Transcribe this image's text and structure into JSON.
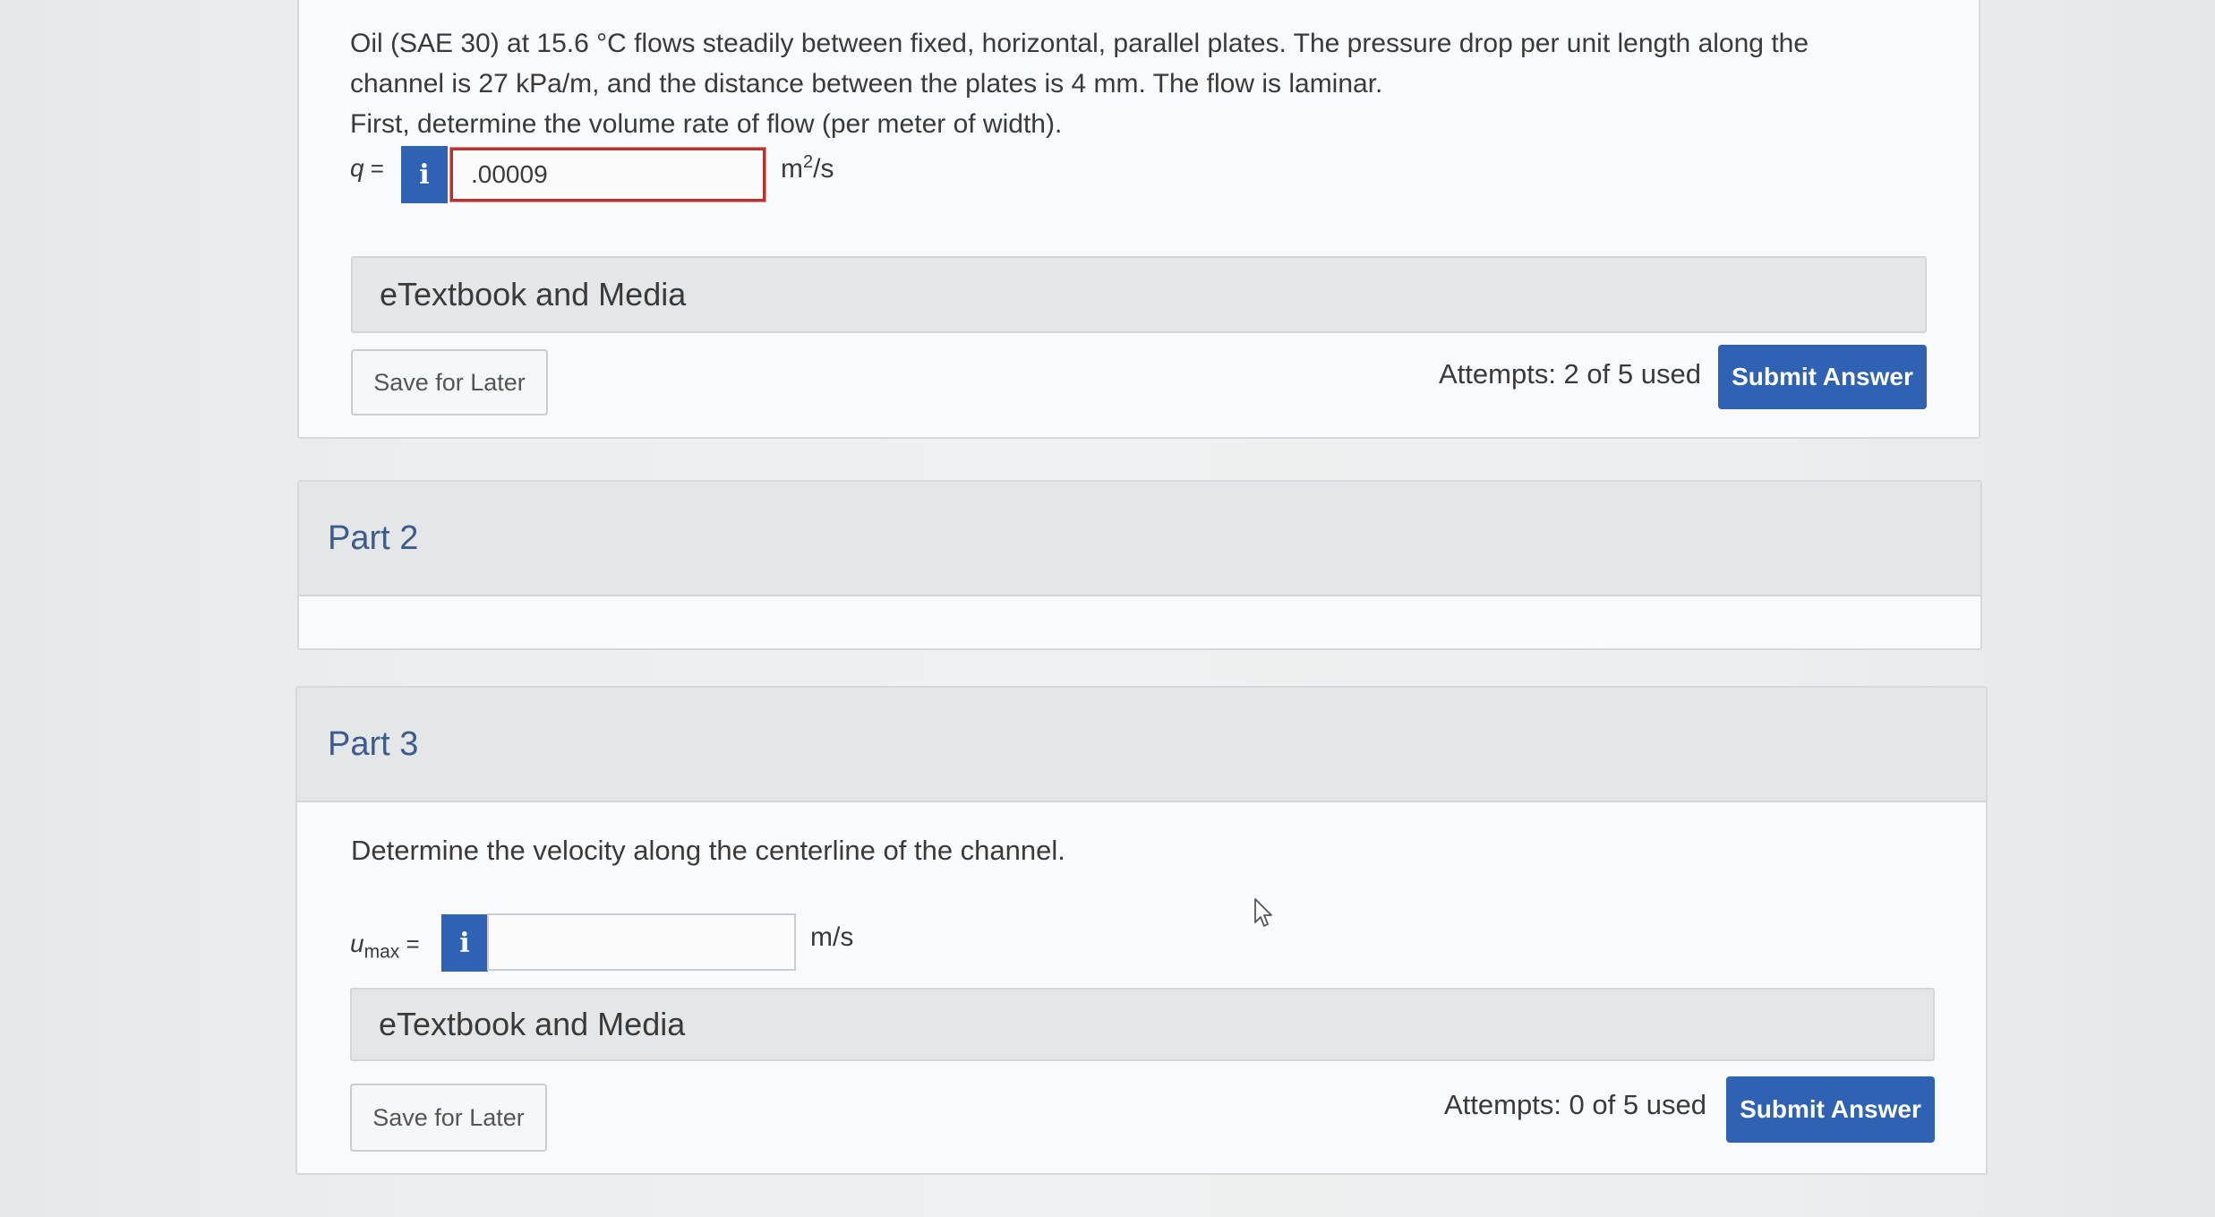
{
  "part1": {
    "problem_text_line1": "Oil (SAE 30) at 15.6 °C flows steadily between fixed, horizontal, parallel plates. The pressure drop per unit length along the",
    "problem_text_line2": "channel is 27 kPa/m, and the distance between the plates is 4 mm. The flow is laminar.",
    "question": "First, determine the volume rate of flow (per meter of width).",
    "answer_label": "q",
    "answer_value": ".00009",
    "unit_base": "m",
    "unit_exp": "2",
    "unit_rest": "/s",
    "media_label": "eTextbook and Media",
    "save_label": "Save for Later",
    "attempts": "Attempts: 2 of 5 used",
    "submit_label": "Submit Answer"
  },
  "part2": {
    "title": "Part 2"
  },
  "part3": {
    "title": "Part 3",
    "question": "Determine the velocity along the centerline of the channel.",
    "answer_label": "u",
    "answer_label_sub": "max",
    "answer_value": "",
    "unit": "m/s",
    "media_label": "eTextbook and Media",
    "save_label": "Save for Later",
    "attempts": "Attempts: 0 of 5 used",
    "submit_label": "Submit Answer"
  },
  "icons": {
    "info": "i"
  },
  "colors": {
    "accent": "#2f62b3",
    "error_border": "#b83232",
    "part_title": "#3b5c8c"
  }
}
